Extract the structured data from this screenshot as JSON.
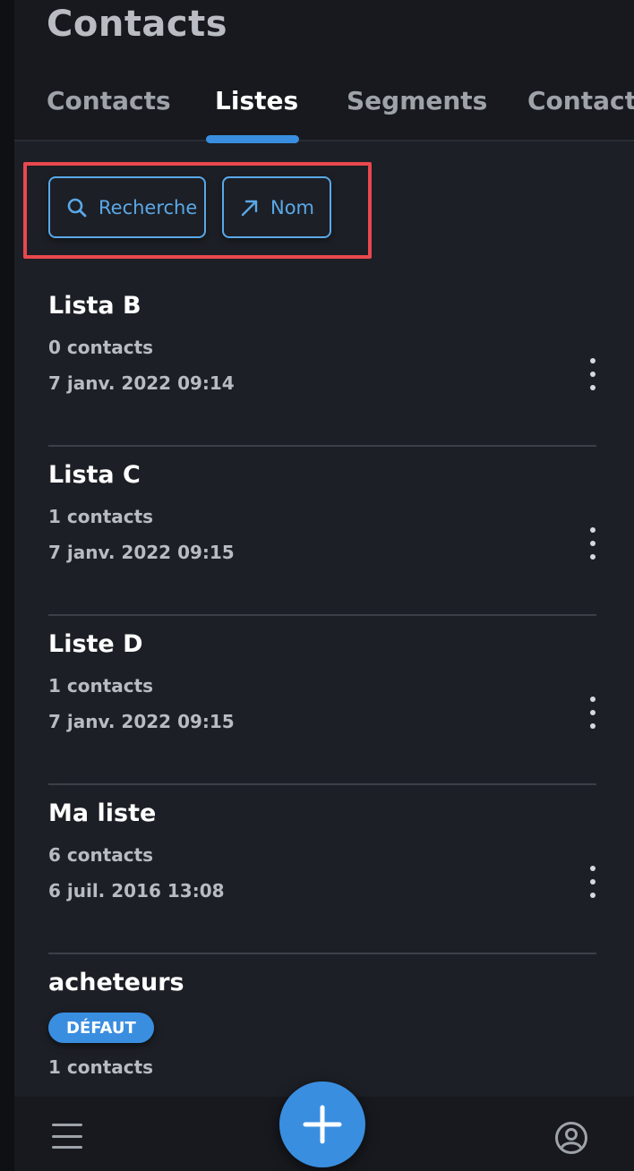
{
  "header": {
    "title": "Contacts",
    "tabs": [
      {
        "label": "Contacts",
        "active": false
      },
      {
        "label": "Listes",
        "active": true
      },
      {
        "label": "Segments",
        "active": false
      },
      {
        "label": "Contacts",
        "active": false
      }
    ]
  },
  "toolbar": {
    "search_label": "Recherche",
    "search_icon": "search-icon",
    "sort_label": "Nom",
    "sort_icon": "arrow-up-right-icon"
  },
  "lists": [
    {
      "name": "Lista B",
      "count": "0 contacts",
      "date": "7 janv. 2022 09:14"
    },
    {
      "name": "Lista C",
      "count": "1 contacts",
      "date": "7 janv. 2022 09:15"
    },
    {
      "name": "Liste D",
      "count": "1 contacts",
      "date": "7 janv. 2022 09:15"
    },
    {
      "name": "Ma liste",
      "count": "6 contacts",
      "date": "6 juil. 2016 13:08"
    },
    {
      "name": "acheteurs",
      "badge": "DÉFAUT",
      "count": "1 contacts"
    }
  ],
  "bottom_nav": {
    "menu_icon": "hamburger-menu-icon",
    "add_icon": "plus-icon",
    "profile_icon": "user-profile-icon"
  },
  "colors": {
    "accent": "#3a8ee0",
    "highlight_frame": "#e8484e",
    "background": "#1c1f25"
  }
}
